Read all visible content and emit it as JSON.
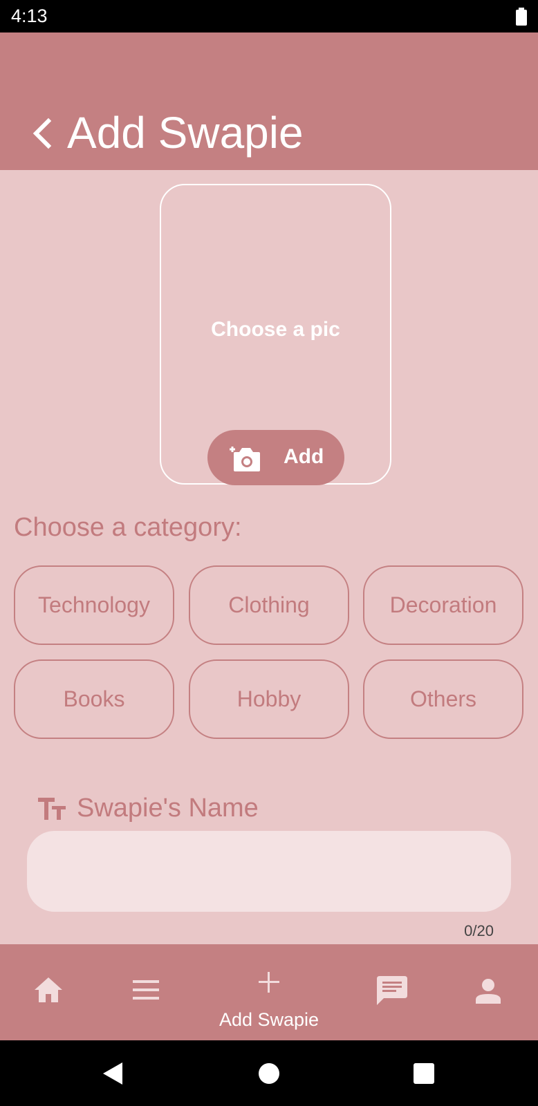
{
  "status_bar": {
    "time": "4:13",
    "battery_icon": "battery-full-icon"
  },
  "app_bar": {
    "title": "Add Swapie",
    "back_icon": "chevron-left-icon"
  },
  "photo": {
    "prompt": "Choose a pic",
    "add_label": "Add",
    "add_icon": "add-camera-icon"
  },
  "category": {
    "label": "Choose a category:",
    "options": [
      "Technology",
      "Clothing",
      "Decoration",
      "Books",
      "Hobby",
      "Others"
    ]
  },
  "name_field": {
    "label": "Swapie's Name",
    "value": "",
    "counter": "0/20",
    "icon": "text-size-icon"
  },
  "bottom_nav": {
    "items": [
      {
        "icon": "home-icon",
        "label": ""
      },
      {
        "icon": "menu-icon",
        "label": ""
      },
      {
        "icon": "plus-icon",
        "label": "Add Swapie"
      },
      {
        "icon": "chat-icon",
        "label": ""
      },
      {
        "icon": "person-icon",
        "label": ""
      }
    ]
  },
  "colors": {
    "primary": "#c48082",
    "background": "#e9c7c8",
    "input_fill": "#f4e2e3",
    "accent_text": "#c27b7e"
  }
}
